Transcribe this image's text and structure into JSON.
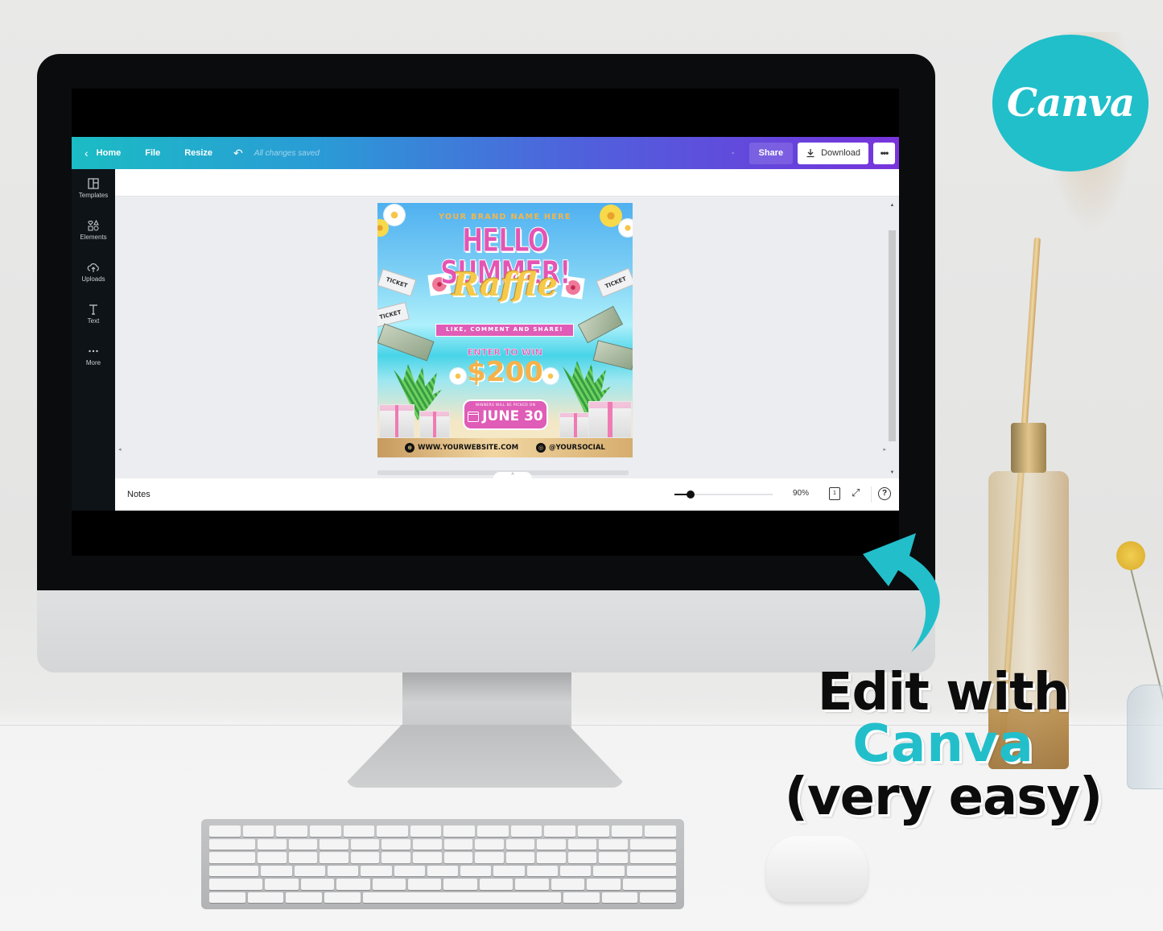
{
  "editor": {
    "topbar": {
      "back_icon": "chevron-left-icon",
      "home": "Home",
      "file": "File",
      "resize": "Resize",
      "undo_icon": "undo-icon",
      "save_status": "All changes saved",
      "dash": "-",
      "share": "Share",
      "download": "Download",
      "download_icon": "download-icon",
      "more": "•••"
    },
    "sidebar": {
      "items": [
        {
          "label": "Templates",
          "icon": "templates-icon"
        },
        {
          "label": "Elements",
          "icon": "elements-icon"
        },
        {
          "label": "Uploads",
          "icon": "upload-cloud-icon"
        },
        {
          "label": "Text",
          "icon": "text-icon"
        },
        {
          "label": "More",
          "icon": "more-dots-icon"
        }
      ]
    },
    "canvas": {
      "scroll_up": "▲",
      "scroll_down": "▼",
      "scroll_left": "◂",
      "scroll_right": "▸",
      "notes_toggle": "^"
    },
    "bottombar": {
      "notes": "Notes",
      "zoom_percent": 90,
      "zoom_label": "90%",
      "page_count": "1",
      "expand": "⤢",
      "help": "?"
    }
  },
  "design": {
    "brand": "YOUR BRAND NAME HERE",
    "title": "HELLO SUMMER!",
    "subtitle": "Raffle",
    "tagline": "LIKE, COMMENT AND SHARE!",
    "enter": "ENTER TO WIN",
    "amount": "$200",
    "winners_note": "WINNERS WILL BE PICKED ON",
    "date": "JUNE 30",
    "website": "WWW.YOURWEBSITE.COM",
    "social": "@YOURSOCIAL",
    "ticket_label": "TICKET"
  },
  "marketing": {
    "logo_text": "Canva",
    "cta_line1": "Edit with",
    "cta_line2": "Canva",
    "cta_line3": "(very easy)",
    "brand_color": "#20bfca"
  }
}
